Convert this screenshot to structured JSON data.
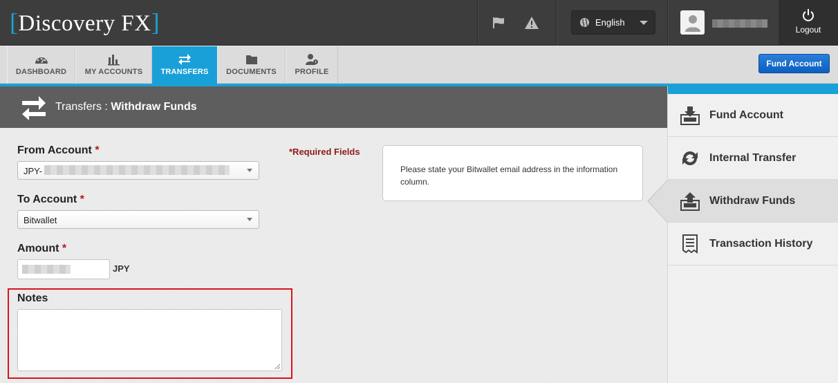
{
  "brand": {
    "logo_text": "Discovery FX",
    "bracket_left": "[",
    "bracket_right": "]"
  },
  "topbar": {
    "flag_icon": "flag-icon",
    "alert_icon": "warning-icon",
    "language": {
      "selected": "English",
      "icon": "globe-icon"
    },
    "user_icon": "user-avatar-icon",
    "logout_label": "Logout",
    "logout_icon": "power-icon"
  },
  "nav": {
    "tabs": [
      {
        "label": "DASHBOARD",
        "icon": "dashboard-icon"
      },
      {
        "label": "MY ACCOUNTS",
        "icon": "bar-chart-icon"
      },
      {
        "label": "TRANSFERS",
        "icon": "transfer-arrows-icon",
        "active": true
      },
      {
        "label": "DOCUMENTS",
        "icon": "folder-icon"
      },
      {
        "label": "PROFILE",
        "icon": "profile-icon"
      }
    ],
    "fund_account_button": "Fund Account"
  },
  "header": {
    "section": "Transfers",
    "separator": " : ",
    "current": "Withdraw Funds"
  },
  "form": {
    "required_fields_note": "*Required Fields",
    "from_account": {
      "label": "From Account",
      "required_mark": "*",
      "value_prefix": "JPY-"
    },
    "to_account": {
      "label": "To Account",
      "required_mark": "*",
      "value": "Bitwallet"
    },
    "amount": {
      "label": "Amount",
      "required_mark": "*",
      "currency": "JPY"
    },
    "notes": {
      "label": "Notes",
      "value": ""
    },
    "info_message": "Please state your Bitwallet email address in the information column."
  },
  "side_menu": {
    "items": [
      {
        "label": "Fund Account",
        "icon": "deposit-icon"
      },
      {
        "label": "Internal Transfer",
        "icon": "transfer-cycle-icon"
      },
      {
        "label": "Withdraw Funds",
        "icon": "withdraw-icon",
        "active": true
      },
      {
        "label": "Transaction History",
        "icon": "receipt-icon"
      }
    ]
  },
  "colors": {
    "accent": "#1aa0d8",
    "button_blue": "#0c5fc0",
    "highlight_border": "#d9141a",
    "required_red": "#8b1a1a"
  }
}
